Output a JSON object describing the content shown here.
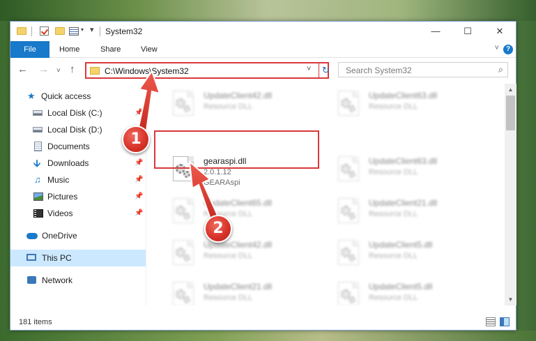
{
  "window": {
    "title": "System32",
    "minimize_glyph": "—",
    "maximize_glyph": "☐",
    "close_glyph": "✕"
  },
  "ribbon": {
    "tabs": [
      "File",
      "Home",
      "Share",
      "View"
    ],
    "help_glyph": "?",
    "collapse_glyph": "˅"
  },
  "address": {
    "path": "C:\\Windows\\System32",
    "search_placeholder": "Search System32",
    "back_glyph": "←",
    "forward_glyph": "→",
    "recent_glyph": "˅",
    "up_glyph": "↑",
    "dropdown_glyph": "˅",
    "refresh_glyph": "↻",
    "search_glyph": "⌕"
  },
  "sidebar": {
    "items": [
      {
        "label": "Quick access",
        "icon": "star-icon"
      },
      {
        "label": "Local Disk (C:)",
        "icon": "drive-icon",
        "pinned": true
      },
      {
        "label": "Local Disk (D:)",
        "icon": "drive-icon",
        "pinned": true
      },
      {
        "label": "Documents",
        "icon": "documents-icon",
        "pinned": true
      },
      {
        "label": "Downloads",
        "icon": "download-icon",
        "pinned": true
      },
      {
        "label": "Music",
        "icon": "music-icon",
        "pinned": true
      },
      {
        "label": "Pictures",
        "icon": "pictures-icon",
        "pinned": true
      },
      {
        "label": "Videos",
        "icon": "videos-icon",
        "pinned": true
      },
      {
        "label": "OneDrive",
        "icon": "onedrive-icon"
      },
      {
        "label": "This PC",
        "icon": "pc-icon",
        "selected": true
      },
      {
        "label": "Network",
        "icon": "network-icon"
      }
    ]
  },
  "files": {
    "left": [
      {
        "name": "UpdateClient42.dll",
        "line2": "Resource DLL",
        "blurred": true
      },
      {
        "name": "gearaspi.dll",
        "line2": "2.0.1.12",
        "line3": "GEARAspi",
        "blurred": false
      },
      {
        "name": "UpdateClient65.dll",
        "line2": "Resource DLL",
        "blurred": true
      },
      {
        "name": "UpdateClient42.dll",
        "line2": "Resource DLL",
        "blurred": true
      },
      {
        "name": "UpdateClient21.dll",
        "line2": "Resource DLL",
        "blurred": true
      }
    ],
    "right": [
      {
        "name": "UpdateClient63.dll",
        "line2": "Resource DLL",
        "blurred": true
      },
      {
        "name": "UpdateClient63.dll",
        "line2": "Resource DLL",
        "blurred": true
      },
      {
        "name": "UpdateClient21.dll",
        "line2": "Resource DLL",
        "blurred": true
      },
      {
        "name": "UpdateClient5.dll",
        "line2": "Resource DLL",
        "blurred": true
      },
      {
        "name": "UpdateClient5.dll",
        "line2": "Resource DLL",
        "blurred": true
      }
    ]
  },
  "status": {
    "item_count": "181 items"
  },
  "annotations": {
    "step1": "1",
    "step2": "2",
    "highlight_color": "#d9383a"
  },
  "colors": {
    "accent": "#1979ca",
    "selection": "#cce8ff"
  }
}
